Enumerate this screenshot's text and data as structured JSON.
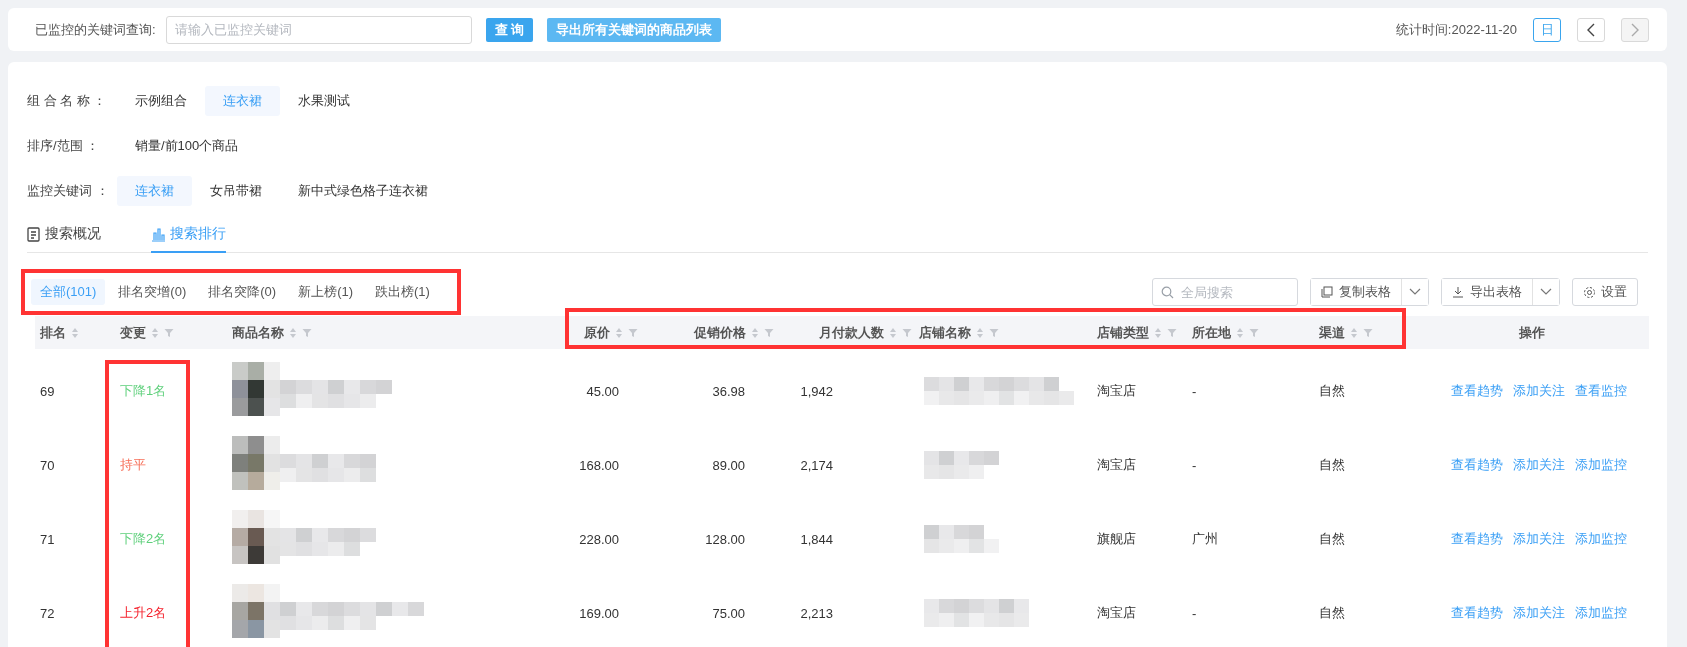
{
  "query_bar": {
    "label": "已监控的关键词查询:",
    "placeholder": "请输入已监控关键词",
    "search_button": "查 询",
    "export_button": "导出所有关键词的商品列表",
    "stat_time": "统计时间:2022-11-20",
    "day_button": "日",
    "prev_disabled": false,
    "next_disabled": true
  },
  "filters": [
    {
      "label": "组 合 名 称 ：",
      "options": [
        {
          "text": "示例组合",
          "selected": false
        },
        {
          "text": "连衣裙",
          "selected": true
        },
        {
          "text": "水果测试",
          "selected": false
        }
      ]
    },
    {
      "label": "排序/范围 ：",
      "options": [
        {
          "text": "销量/前100个商品",
          "selected": false
        }
      ]
    },
    {
      "label": "监控关键词 ：",
      "options": [
        {
          "text": "连衣裙",
          "selected": true
        },
        {
          "text": "女吊带裙",
          "selected": false
        },
        {
          "text": "新中式绿色格子连衣裙",
          "selected": false
        }
      ]
    }
  ],
  "view_tabs": [
    {
      "label": "搜索概况",
      "kind": "doc",
      "selected": false
    },
    {
      "label": "搜索排行",
      "kind": "chart",
      "selected": true
    }
  ],
  "sub_tabs": [
    {
      "label": "全部(101)",
      "selected": true
    },
    {
      "label": "排名突增(0)",
      "selected": false
    },
    {
      "label": "排名突降(0)",
      "selected": false
    },
    {
      "label": "新上榜(1)",
      "selected": false
    },
    {
      "label": "跌出榜(1)",
      "selected": false
    }
  ],
  "toolbar": {
    "search_placeholder": "全局搜索",
    "copy_button": "复制表格",
    "export_button": "导出表格",
    "settings_button": "设置"
  },
  "columns": [
    {
      "label": "排名",
      "sortable": true,
      "filterable": false
    },
    {
      "label": "变更",
      "sortable": true,
      "filterable": true
    },
    {
      "label": "商品名称",
      "sortable": true,
      "filterable": true
    },
    {
      "label": "原价",
      "sortable": true,
      "filterable": true
    },
    {
      "label": "促销价格",
      "sortable": true,
      "filterable": true
    },
    {
      "label": "月付款人数",
      "sortable": true,
      "filterable": true
    },
    {
      "label": "店铺名称",
      "sortable": true,
      "filterable": true
    },
    {
      "label": "店铺类型",
      "sortable": true,
      "filterable": true
    },
    {
      "label": "所在地",
      "sortable": true,
      "filterable": true
    },
    {
      "label": "渠道",
      "sortable": true,
      "filterable": true
    },
    {
      "label": "操作",
      "sortable": false,
      "filterable": false
    }
  ],
  "rows": [
    {
      "rank": "69",
      "change": {
        "text": "下降1名",
        "kind": "down"
      },
      "price": "45.00",
      "promo_price": "36.98",
      "buyers": "1,942",
      "store_type": "淘宝店",
      "location": "-",
      "channel": "自然",
      "actions": [
        "查看趋势",
        "添加关注",
        "查看监控"
      ]
    },
    {
      "rank": "70",
      "change": {
        "text": "持平",
        "kind": "flat"
      },
      "price": "168.00",
      "promo_price": "89.00",
      "buyers": "2,174",
      "store_type": "淘宝店",
      "location": "-",
      "channel": "自然",
      "actions": [
        "查看趋势",
        "添加关注",
        "添加监控"
      ]
    },
    {
      "rank": "71",
      "change": {
        "text": "下降2名",
        "kind": "down"
      },
      "price": "228.00",
      "promo_price": "128.00",
      "buyers": "1,844",
      "store_type": "旗舰店",
      "location": "广州",
      "channel": "自然",
      "actions": [
        "查看趋势",
        "添加关注",
        "添加监控"
      ]
    },
    {
      "rank": "72",
      "change": {
        "text": "上升2名",
        "kind": "up"
      },
      "price": "169.00",
      "promo_price": "75.00",
      "buyers": "2,213",
      "store_type": "淘宝店",
      "location": "-",
      "channel": "自然",
      "actions": [
        "查看趋势",
        "添加关注",
        "添加监控"
      ]
    }
  ]
}
